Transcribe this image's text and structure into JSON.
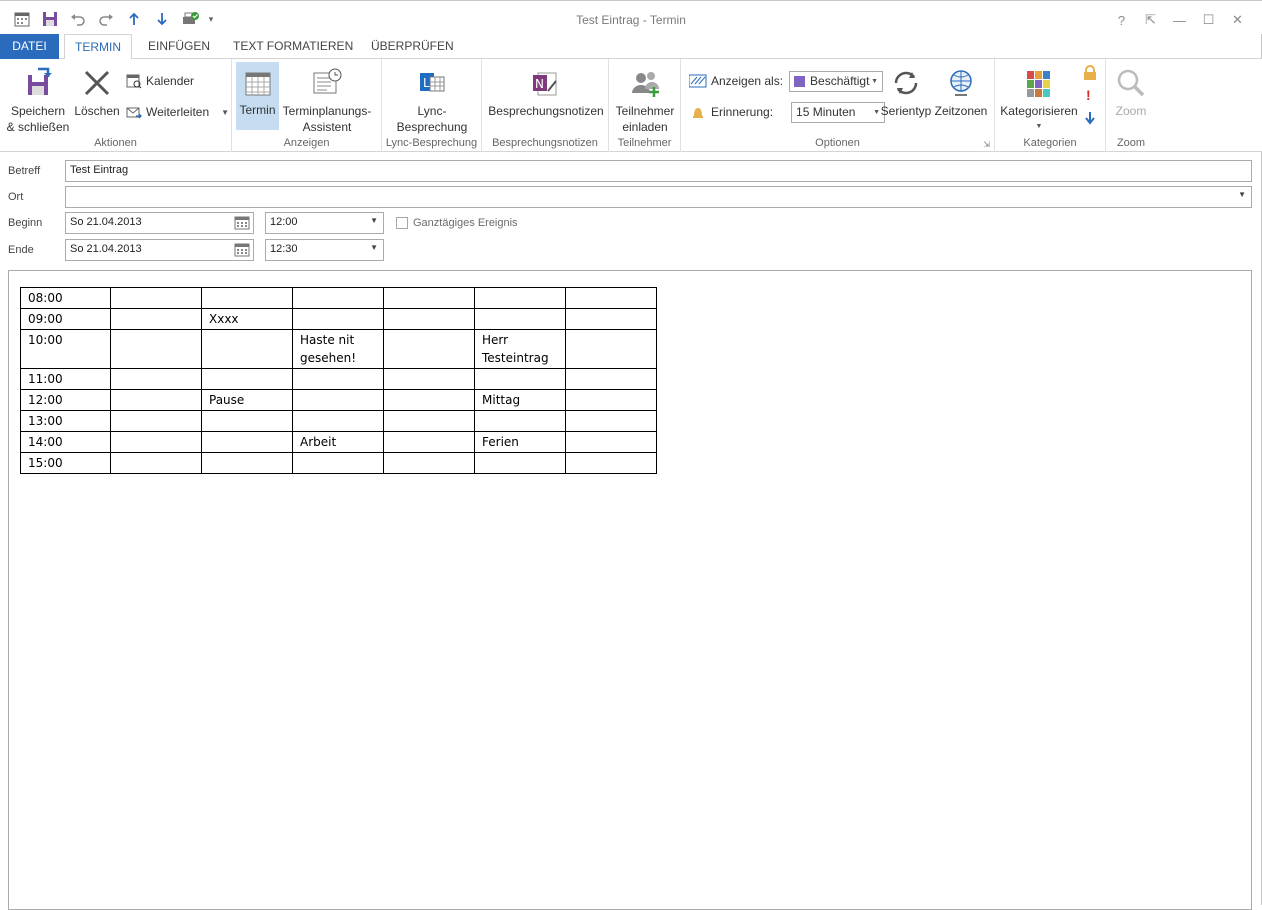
{
  "window": {
    "title": "Test Eintrag - Termin",
    "controls": [
      "?",
      "⇱",
      "—",
      "☐",
      "✕"
    ]
  },
  "tabs": [
    "DATEI",
    "TERMIN",
    "EINFÜGEN",
    "TEXT FORMATIEREN",
    "ÜBERPRÜFEN"
  ],
  "ribbon": {
    "aktionen": {
      "label": "Aktionen",
      "save": "Speichern\n& schließen",
      "save_l1": "Speichern",
      "save_l2": "& schließen",
      "delete": "Löschen",
      "calendar": "Kalender",
      "forward": "Weiterleiten"
    },
    "anzeigen": {
      "label": "Anzeigen",
      "termin": "Termin",
      "assist_l1": "Terminplanungs-",
      "assist_l2": "Assistent"
    },
    "lync": {
      "label": "Lync-Besprechung",
      "l1": "Lync-",
      "l2": "Besprechung"
    },
    "notizen": {
      "label": "Besprechungsnotizen",
      "btn": "Besprechungsnotizen"
    },
    "teilnehmer": {
      "label": "Teilnehmer",
      "l1": "Teilnehmer",
      "l2": "einladen"
    },
    "optionen": {
      "label": "Optionen",
      "show_as_label": "Anzeigen als:",
      "show_as_value": "Beschäftigt",
      "reminder_label": "Erinnerung:",
      "reminder_value": "15 Minuten",
      "recurrence": "Serientyp",
      "timezones": "Zeitzonen"
    },
    "kategorien": {
      "label": "Kategorien",
      "categorize": "Kategorisieren"
    },
    "zoom": {
      "label": "Zoom",
      "btn": "Zoom"
    }
  },
  "form": {
    "subject_label": "Betreff",
    "subject_value": "Test Eintrag",
    "location_label": "Ort",
    "location_value": "",
    "start_label": "Beginn",
    "start_date": "So 21.04.2013",
    "start_time": "12:00",
    "allday_label": "Ganztägiges Ereignis",
    "end_label": "Ende",
    "end_date": "So 21.04.2013",
    "end_time": "12:30"
  },
  "schedule": {
    "rows": [
      [
        "08:00",
        "",
        "",
        "",
        "",
        "",
        ""
      ],
      [
        "09:00",
        "",
        "Xxxx",
        "",
        "",
        "",
        ""
      ],
      [
        "10:00",
        "",
        "",
        "Haste nit gesehen!",
        "",
        "Herr Testeintrag",
        ""
      ],
      [
        "11:00",
        "",
        "",
        "",
        "",
        "",
        ""
      ],
      [
        "12:00",
        "",
        "Pause",
        "",
        "",
        "Mittag",
        ""
      ],
      [
        "13:00",
        "",
        "",
        "",
        "",
        "",
        ""
      ],
      [
        "14:00",
        "",
        "",
        "Arbeit",
        "",
        "Ferien",
        ""
      ],
      [
        "15:00",
        "",
        "",
        "",
        "",
        "",
        ""
      ]
    ]
  },
  "colors": {
    "accent": "#2a6bbd",
    "selected": "#c5dcf1",
    "busy": "#8064c4"
  }
}
